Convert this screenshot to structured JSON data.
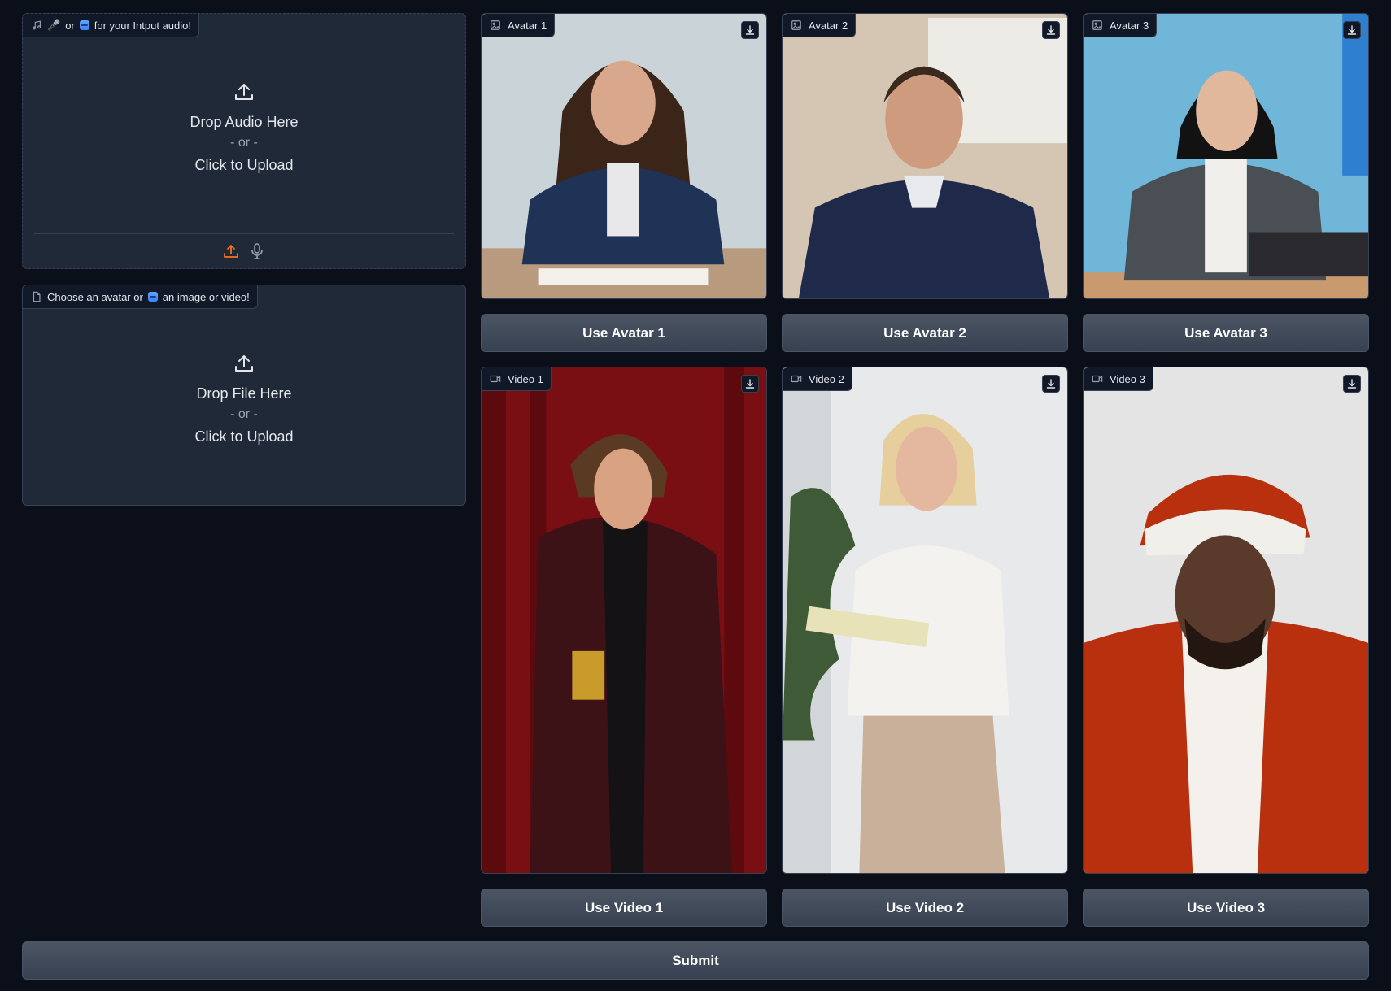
{
  "audio_input": {
    "label_or": "or",
    "label_text": "for your Intput audio!",
    "drop_title": "Drop Audio Here",
    "drop_or": "- or -",
    "drop_click": "Click to Upload"
  },
  "file_input": {
    "label_prefix": "Choose an avatar or",
    "label_suffix": "an image or video!",
    "drop_title": "Drop File Here",
    "drop_or": "- or -",
    "drop_click": "Click to Upload"
  },
  "avatars": [
    {
      "label": "Avatar 1",
      "button": "Use Avatar 1"
    },
    {
      "label": "Avatar 2",
      "button": "Use Avatar 2"
    },
    {
      "label": "Avatar 3",
      "button": "Use Avatar 3"
    }
  ],
  "videos": [
    {
      "label": "Video 1",
      "button": "Use Video 1"
    },
    {
      "label": "Video 2",
      "button": "Use Video 2"
    },
    {
      "label": "Video 3",
      "button": "Use Video 3"
    }
  ],
  "submit_label": "Submit",
  "colors": {
    "background": "#0b0f19",
    "panel": "#1f2937",
    "border": "#374151",
    "accent_upload": "#f97316",
    "button": "#4b5563"
  }
}
